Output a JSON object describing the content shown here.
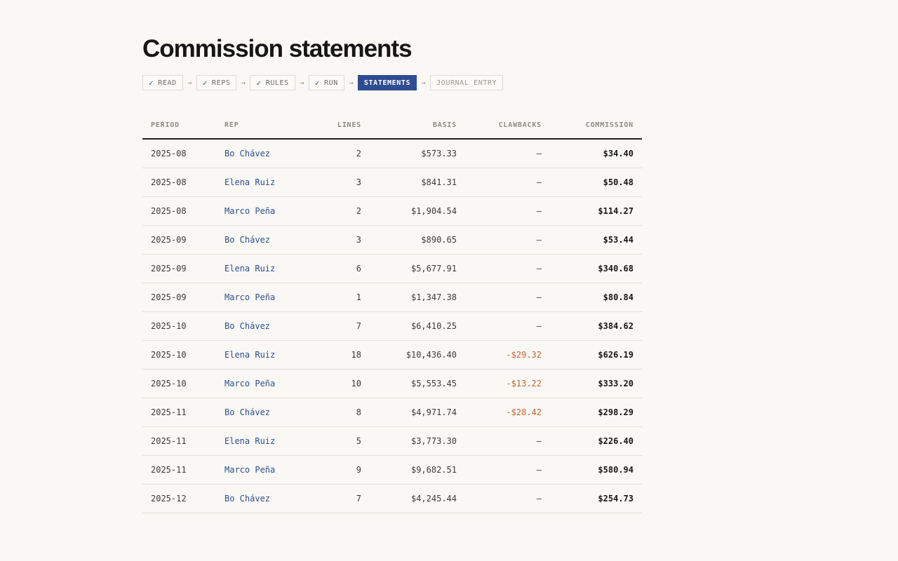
{
  "page": {
    "title": "Commission statements"
  },
  "steps": [
    {
      "label": "READ",
      "state": "done"
    },
    {
      "label": "REPS",
      "state": "done"
    },
    {
      "label": "RULES",
      "state": "done"
    },
    {
      "label": "RUN",
      "state": "done"
    },
    {
      "label": "STATEMENTS",
      "state": "active"
    },
    {
      "label": "JOURNAL ENTRY",
      "state": "pending"
    }
  ],
  "icons": {
    "check": "✓",
    "arrow": "→"
  },
  "colors": {
    "accent": "#2e4d91",
    "clawback": "#c4632d",
    "background": "#f9f8f4"
  },
  "table": {
    "columns": [
      "PERIOD",
      "REP",
      "LINES",
      "BASIS",
      "CLAWBACKS",
      "COMMISSION"
    ],
    "rows": [
      {
        "period": "2025-08",
        "rep": "Bo Chávez",
        "lines": "2",
        "basis": "$573.33",
        "clawbacks": "—",
        "commission": "$34.40"
      },
      {
        "period": "2025-08",
        "rep": "Elena Ruiz",
        "lines": "3",
        "basis": "$841.31",
        "clawbacks": "—",
        "commission": "$50.48"
      },
      {
        "period": "2025-08",
        "rep": "Marco Peña",
        "lines": "2",
        "basis": "$1,904.54",
        "clawbacks": "—",
        "commission": "$114.27"
      },
      {
        "period": "2025-09",
        "rep": "Bo Chávez",
        "lines": "3",
        "basis": "$890.65",
        "clawbacks": "—",
        "commission": "$53.44"
      },
      {
        "period": "2025-09",
        "rep": "Elena Ruiz",
        "lines": "6",
        "basis": "$5,677.91",
        "clawbacks": "—",
        "commission": "$340.68"
      },
      {
        "period": "2025-09",
        "rep": "Marco Peña",
        "lines": "1",
        "basis": "$1,347.38",
        "clawbacks": "—",
        "commission": "$80.84"
      },
      {
        "period": "2025-10",
        "rep": "Bo Chávez",
        "lines": "7",
        "basis": "$6,410.25",
        "clawbacks": "—",
        "commission": "$384.62"
      },
      {
        "period": "2025-10",
        "rep": "Elena Ruiz",
        "lines": "18",
        "basis": "$10,436.40",
        "clawbacks": "-$29.32",
        "commission": "$626.19"
      },
      {
        "period": "2025-10",
        "rep": "Marco Peña",
        "lines": "10",
        "basis": "$5,553.45",
        "clawbacks": "-$13.22",
        "commission": "$333.20"
      },
      {
        "period": "2025-11",
        "rep": "Bo Chávez",
        "lines": "8",
        "basis": "$4,971.74",
        "clawbacks": "-$28.42",
        "commission": "$298.29"
      },
      {
        "period": "2025-11",
        "rep": "Elena Ruiz",
        "lines": "5",
        "basis": "$3,773.30",
        "clawbacks": "—",
        "commission": "$226.40"
      },
      {
        "period": "2025-11",
        "rep": "Marco Peña",
        "lines": "9",
        "basis": "$9,682.51",
        "clawbacks": "—",
        "commission": "$580.94"
      },
      {
        "period": "2025-12",
        "rep": "Bo Chávez",
        "lines": "7",
        "basis": "$4,245.44",
        "clawbacks": "—",
        "commission": "$254.73"
      }
    ]
  }
}
